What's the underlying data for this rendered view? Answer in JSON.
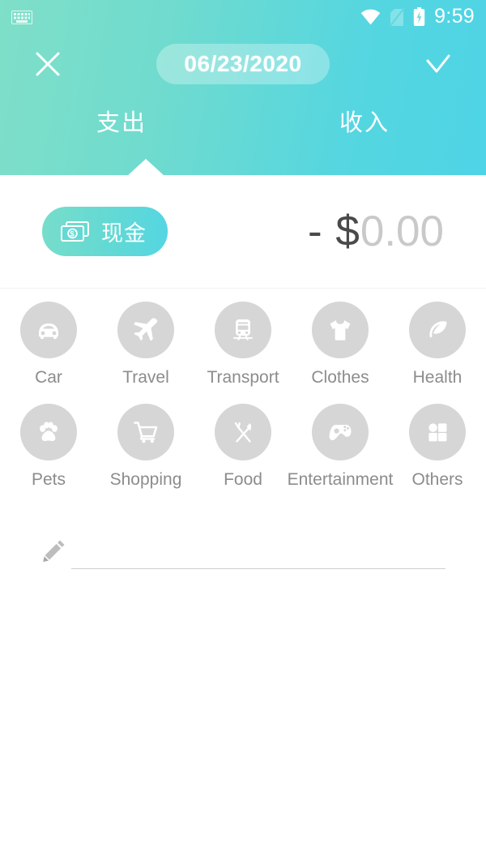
{
  "statusbar": {
    "keyboard_icon": "keyboard-icon",
    "wifi_icon": "wifi-icon",
    "sim_icon": "sim-card-off-icon",
    "battery_icon": "battery-charging-icon",
    "time": "9:59"
  },
  "topbar": {
    "close_icon": "close-icon",
    "confirm_icon": "check-icon",
    "date": "06/23/2020"
  },
  "tabs": [
    {
      "label": "支出",
      "active": true
    },
    {
      "label": "收入",
      "active": false
    }
  ],
  "amount_row": {
    "account_icon": "banknote-dollar-icon",
    "account_label": "现金",
    "amount_sign": "- $",
    "amount_value": "0.00"
  },
  "categories": [
    {
      "label": "Car",
      "icon": "car-icon"
    },
    {
      "label": "Travel",
      "icon": "airplane-icon"
    },
    {
      "label": "Transport",
      "icon": "train-icon"
    },
    {
      "label": "Clothes",
      "icon": "tshirt-icon"
    },
    {
      "label": "Health",
      "icon": "leaf-icon"
    },
    {
      "label": "Pets",
      "icon": "paw-icon"
    },
    {
      "label": "Shopping",
      "icon": "shopping-cart-icon"
    },
    {
      "label": "Food",
      "icon": "fork-knife-icon"
    },
    {
      "label": "Entertainment",
      "icon": "gamepad-icon"
    },
    {
      "label": "Others",
      "icon": "grid-icon"
    }
  ],
  "note": {
    "icon": "pencil-icon",
    "value": "",
    "placeholder": ""
  },
  "colors": {
    "header_gradient_start": "#7fdfc8",
    "header_gradient_end": "#4ed4e6",
    "accent": "#5cd8dc",
    "category_circle": "#d6d6d6",
    "label_gray": "#8c8c8c",
    "amount_dark": "#4a4a4a",
    "amount_light": "#c9c9c9"
  }
}
